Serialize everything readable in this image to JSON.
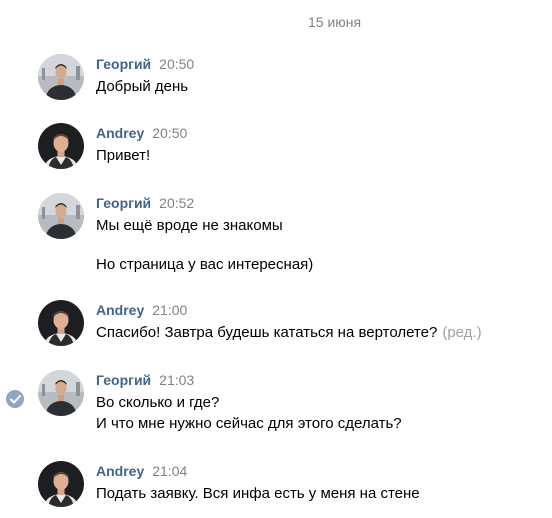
{
  "date_label": "15 июня",
  "messages": [
    {
      "author": "Георгий",
      "time": "20:50",
      "lines": [
        "Добрый день"
      ]
    },
    {
      "author": "Andrey",
      "time": "20:50",
      "lines": [
        "Привет!"
      ]
    },
    {
      "author": "Георгий",
      "time": "20:52",
      "lines": [
        "Мы ещё вроде не знакомы",
        "Но страница у вас интересная)"
      ]
    },
    {
      "author": "Andrey",
      "time": "21:00",
      "lines": [
        "Спасибо! Завтра будешь кататься на вертолете?"
      ],
      "edited_label": "(ред.)"
    },
    {
      "author": "Георгий",
      "time": "21:03",
      "lines": [
        "Во сколько и где?",
        "И что мне нужно сейчас для этого сделать?"
      ]
    },
    {
      "author": "Andrey",
      "time": "21:04",
      "lines": [
        "Подать заявку. Вся инфа есть у меня на стене"
      ]
    }
  ],
  "colors": {
    "author": "#42648b",
    "meta": "#828282",
    "check": "#8ea6c2"
  }
}
